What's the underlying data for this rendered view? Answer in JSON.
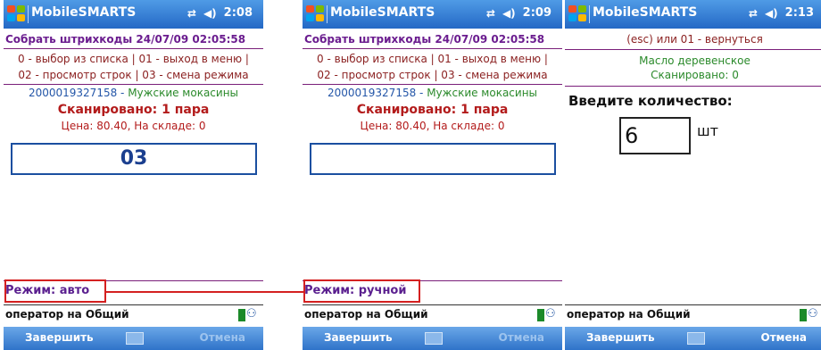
{
  "app": {
    "title": "MobileSMARTS"
  },
  "screens": [
    {
      "time": "2:08",
      "header": "Собрать штрихкоды 24/07/09 02:05:58",
      "hint1": "0 - выбор из списка | 01 - выход в меню |",
      "hint2": "02 - просмотр строк | 03 - смена режима",
      "code": "2000019327158",
      "code_sep": " - ",
      "product": "Мужские мокасины",
      "scanned": "Сканировано: 1 пара",
      "price": "Цена: 80.40, На складе: 0",
      "input_value": "03",
      "mode": "Режим: авто",
      "operator": "оператор на Общий",
      "left_soft": "Завершить",
      "right_soft": "Отмена"
    },
    {
      "time": "2:09",
      "header": "Собрать штрихкоды 24/07/09 02:05:58",
      "hint1": "0 - выбор из списка | 01 - выход в меню |",
      "hint2": "02 - просмотр строк | 03 - смена режима",
      "code": "2000019327158",
      "code_sep": " - ",
      "product": "Мужские мокасины",
      "scanned": "Сканировано: 1 пара",
      "price": "Цена: 80.40, На складе: 0",
      "input_value": "",
      "mode": "Режим: ручной",
      "operator": "оператор на Общий",
      "left_soft": "Завершить",
      "right_soft": "Отмена"
    },
    {
      "time": "2:13",
      "esc_hint": "(esc) или 01 - вернуться",
      "product": "Масло деревенское",
      "scanned": "Сканировано: 0",
      "qty_label": "Введите количество:",
      "qty_value": "6",
      "unit": "шт",
      "operator": "оператор на Общий",
      "left_soft": "Завершить",
      "right_soft": "Отмена"
    }
  ],
  "icons": {
    "start": "windows-flag-icon",
    "connectivity": "sync-arrows-icon",
    "volume": "speaker-icon",
    "keyboard": "keyboard-icon",
    "operator": "operator-status-icon"
  },
  "colors": {
    "titlebar": "#2468c5",
    "highlight": "#d42020",
    "scanned": "#b31b1b",
    "product": "#2b8a2b"
  }
}
